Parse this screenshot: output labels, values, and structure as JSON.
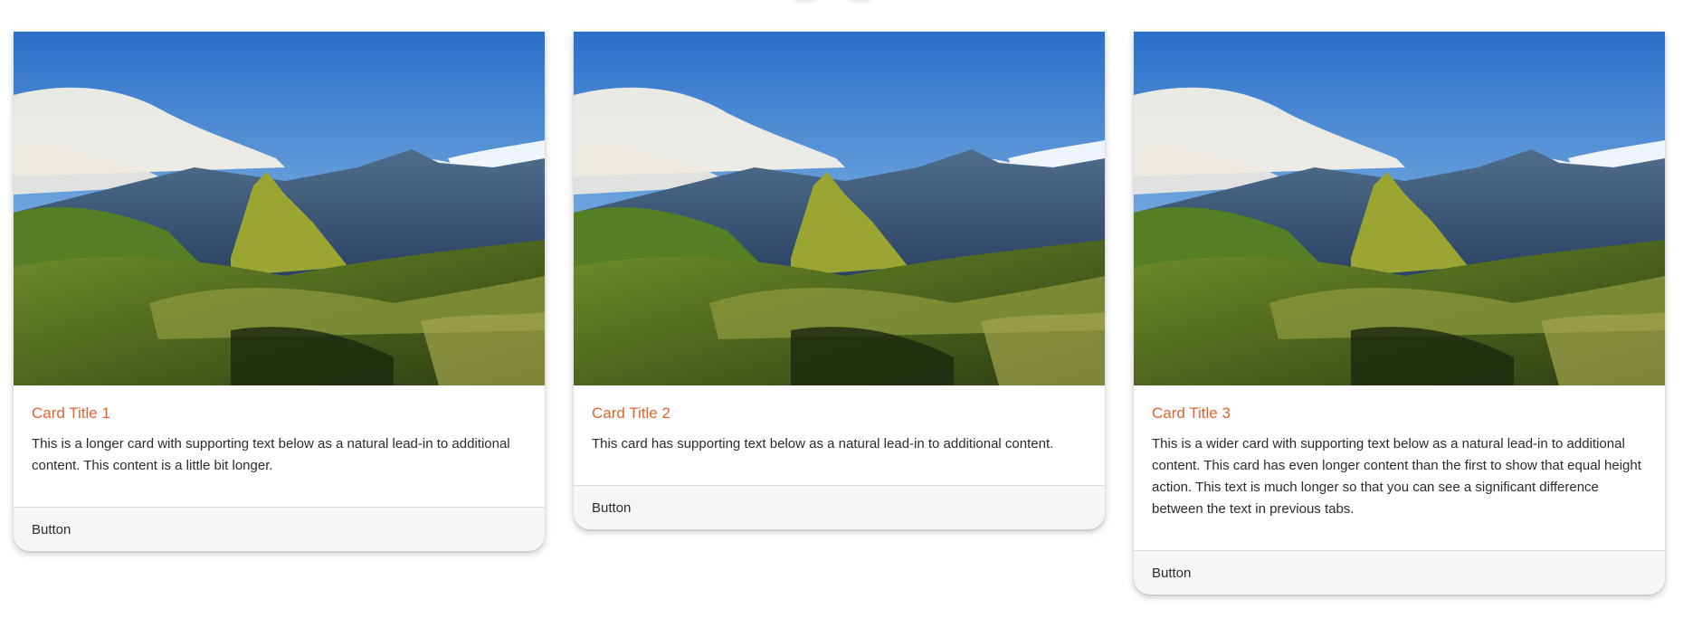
{
  "cards": [
    {
      "image_alt": "Machu Picchu mountain landscape",
      "title": "Card Title 1",
      "text": "This is a longer card with supporting text below as a natural lead-in to additional content. This content is a little bit longer.",
      "button_label": "Button"
    },
    {
      "image_alt": "Machu Picchu mountain landscape",
      "title": "Card Title 2",
      "text": "This card has supporting text below as a natural lead-in to additional content.",
      "button_label": "Button"
    },
    {
      "image_alt": "Machu Picchu mountain landscape",
      "title": "Card Title 3",
      "text": "This is a wider card with supporting text below as a natural lead-in to additional content. This card has even longer content than the first to show that equal height action. This text is much longer so that you can see a significant difference between the text in previous tabs.",
      "button_label": "Button"
    }
  ],
  "colors": {
    "title_accent": "#e0642f",
    "footer_bg": "#f6f6f6"
  }
}
